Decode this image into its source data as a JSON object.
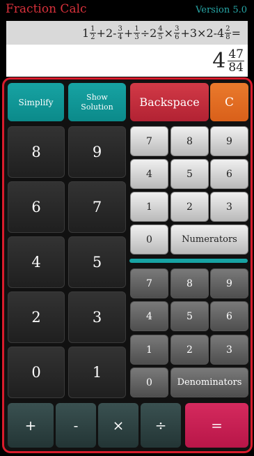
{
  "header": {
    "title": "Fraction Calc",
    "version": "Version 5.0"
  },
  "display": {
    "expression": [
      {
        "w": "1",
        "n": "1",
        "d": "2"
      },
      {
        "op": "+2-"
      },
      {
        "n": "3",
        "d": "4"
      },
      {
        "op": "+"
      },
      {
        "n": "1",
        "d": "3"
      },
      {
        "op": "÷2"
      },
      {
        "n": "4",
        "d": "5"
      },
      {
        "op": "×"
      },
      {
        "n": "3",
        "d": "6"
      },
      {
        "op": "+3×2-4"
      },
      {
        "n": "2",
        "d": "8"
      },
      {
        "op": "="
      }
    ],
    "result": {
      "whole": "4",
      "num": "47",
      "den": "84"
    }
  },
  "buttons": {
    "simplify": "Simplify",
    "show_solution": "Show Solution",
    "backspace": "Backspace",
    "clear": "C",
    "whole_digits": [
      "8",
      "9",
      "6",
      "7",
      "4",
      "5",
      "2",
      "3",
      "0",
      "1"
    ],
    "numerator_digits": [
      "7",
      "8",
      "9",
      "4",
      "5",
      "6",
      "1",
      "2",
      "3",
      "0"
    ],
    "numerators": "Numerators",
    "denominator_digits": [
      "7",
      "8",
      "9",
      "4",
      "5",
      "6",
      "1",
      "2",
      "3",
      "0"
    ],
    "denominators": "Denominators",
    "ops": [
      "+",
      "-",
      "×",
      "÷"
    ],
    "equals": "="
  }
}
